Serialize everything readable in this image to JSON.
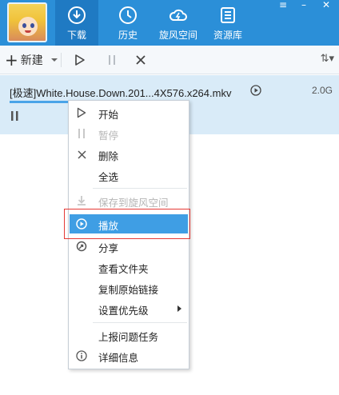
{
  "nav": {
    "tabs": [
      {
        "label": "下载",
        "icon": "download-icon",
        "active": true
      },
      {
        "label": "历史",
        "icon": "history-icon",
        "active": false
      },
      {
        "label": "旋风空间",
        "icon": "whirlwind-cloud-icon",
        "active": false
      },
      {
        "label": "资源库",
        "icon": "resource-library-icon",
        "active": false
      }
    ]
  },
  "window_controls": {
    "menu": "≡",
    "minimize": "–",
    "close": "✕"
  },
  "toolbar": {
    "new_label": "新建",
    "new_plus": "+",
    "sort_label": "⇅▾",
    "buttons": [
      "start-icon",
      "pause-icon",
      "delete-icon"
    ]
  },
  "task": {
    "title": "[极速]White.House.Down.201...4X576.x264.mkv",
    "size": "2.0G",
    "status_icon": "pause-icon"
  },
  "context_menu": {
    "items": [
      {
        "label": "开始",
        "icon": "play-outline-icon",
        "disabled": false
      },
      {
        "label": "暂停",
        "icon": "pause-icon",
        "disabled": true
      },
      {
        "label": "删除",
        "icon": "close-icon",
        "disabled": false
      },
      {
        "label": "全选",
        "icon": "",
        "disabled": false
      },
      {
        "label": "保存到旋风空间",
        "icon": "save-cloud-icon",
        "disabled": true
      },
      {
        "label": "播放",
        "icon": "play-circle-icon",
        "disabled": false,
        "highlighted": true
      },
      {
        "label": "分享",
        "icon": "share-icon",
        "disabled": false
      },
      {
        "label": "查看文件夹",
        "icon": "",
        "disabled": false
      },
      {
        "label": "复制原始链接",
        "icon": "",
        "disabled": false
      },
      {
        "label": "设置优先级",
        "icon": "",
        "disabled": false,
        "submenu": true
      },
      {
        "label": "上报问题任务",
        "icon": "",
        "disabled": false
      },
      {
        "label": "详细信息",
        "icon": "info-icon",
        "disabled": false
      }
    ]
  },
  "colors": {
    "topbar": "#2b8fd8",
    "active_tab": "#1f7ac3",
    "highlight": "#3f9ee4",
    "annotation": "#e53935"
  }
}
